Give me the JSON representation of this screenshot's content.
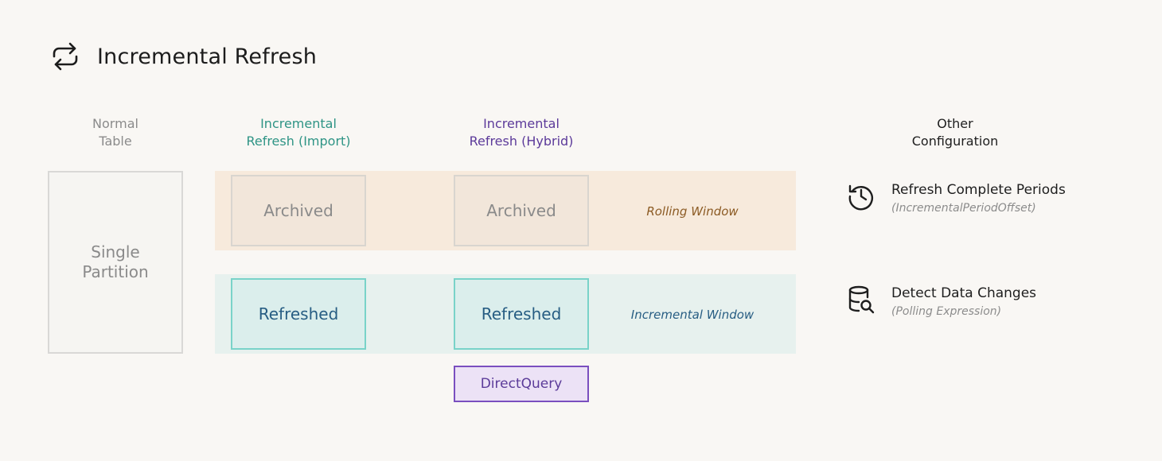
{
  "header": {
    "title": "Incremental Refresh",
    "icon": "refresh-cycle-icon"
  },
  "columns": {
    "normal": "Normal\nTable",
    "import": "Incremental\nRefresh (Import)",
    "hybrid": "Incremental\nRefresh (Hybrid)",
    "other": "Other\nConfiguration"
  },
  "normal_table": {
    "label": "Single\nPartition"
  },
  "import_partitions": {
    "archived": "Archived",
    "refreshed": "Refreshed"
  },
  "hybrid_partitions": {
    "archived": "Archived",
    "refreshed": "Refreshed",
    "directquery": "DirectQuery"
  },
  "windows": {
    "rolling": "Rolling Window",
    "incremental": "Incremental Window"
  },
  "configuration": {
    "items": [
      {
        "title": "Refresh Complete Periods",
        "subtitle": "(IncrementalPeriodOffset)",
        "icon": "history-clock-icon"
      },
      {
        "title": "Detect Data Changes",
        "subtitle": "(Polling Expression)",
        "icon": "database-search-icon"
      }
    ]
  },
  "colors": {
    "import_accent": "#2e9485",
    "hybrid_accent": "#5c3a9a",
    "rolling_band": "#f7eadc",
    "incremental_band": "#e7f1ee",
    "refreshed_border": "#79d3c9",
    "directquery_border": "#7a4fbf"
  }
}
